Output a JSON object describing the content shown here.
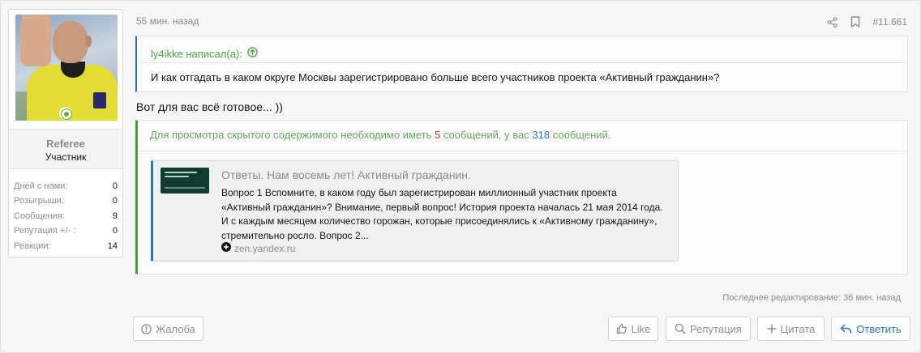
{
  "post": {
    "time": "55 мин. назад",
    "number": "#11.661",
    "share_icon": "share-icon",
    "bookmark_icon": "bookmark-icon"
  },
  "user": {
    "name": "Referee",
    "title": "Участник",
    "online": true,
    "stats": [
      {
        "label": "Дней с нами:",
        "value": "0"
      },
      {
        "label": "Розыгрыши:",
        "value": "0"
      },
      {
        "label": "Сообщения:",
        "value": "9"
      },
      {
        "label": "Репутация +/- :",
        "value": "0"
      },
      {
        "label": "Реакции:",
        "value": "14"
      }
    ]
  },
  "quote": {
    "author": "ly4ikke написал(а):",
    "text": "И как отгадать в каком округе Москвы зарегистрировано больше всего участников проекта «Активный гражданин»?"
  },
  "body_text": "Вот для вас всё готовое... ))",
  "hidden": {
    "before": "Для просмотра скрытого содержимого необходимо иметь",
    "required": "5",
    "middle": "сообщений, у вас",
    "have": "318",
    "after": "сообщений."
  },
  "embed": {
    "title": "Ответы. Нам восемь лет! Активный гражданин.",
    "description": "Вопрос 1 Вспомните, в каком году был зарегистрирован миллионный участник проекта «Активный гражданин»? Внимание, первый вопрос! История проекта началась 21 мая 2014 года. И с каждым месяцем количество горожан, которые присоединялись к «Активному гражданину», стремительно росло. Вопрос 2...",
    "source": "zen.yandex.ru"
  },
  "edited": "Последнее редактирование: 36 мин. назад",
  "buttons": {
    "report": "Жалоба",
    "like": "Like",
    "reputation": "Репутация",
    "quote": "Цитата",
    "reply": "Ответить"
  },
  "colors": {
    "accent": "#2577b1",
    "hidden_green": "#63a85a",
    "required_red": "#c0392b",
    "online": "#63b132"
  }
}
